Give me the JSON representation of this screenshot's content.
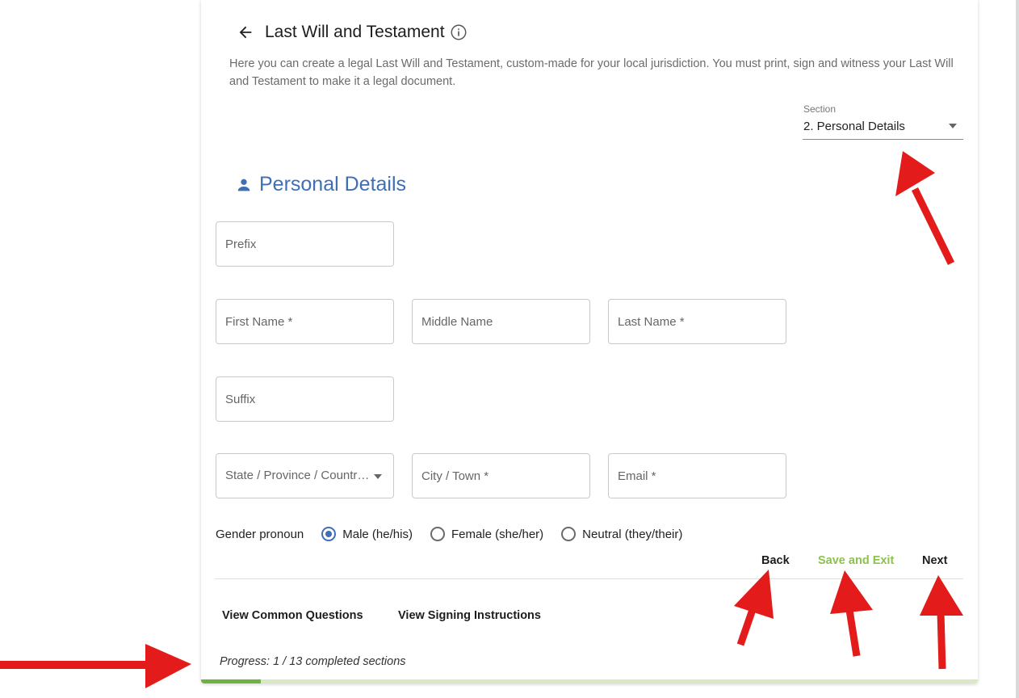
{
  "header": {
    "title": "Last Will and Testament",
    "back_icon": "arrow-left-icon",
    "info_icon": "info-circle-icon"
  },
  "description": "Here you can create a legal Last Will and Testament, custom-made for your local jurisdiction. You must print, sign and witness your Last Will and Testament to make it a legal document.",
  "section_select": {
    "label": "Section",
    "value": "2. Personal Details"
  },
  "personal_details": {
    "heading": "Personal Details",
    "icon": "person-icon"
  },
  "fields": {
    "prefix": {
      "placeholder": "Prefix",
      "value": ""
    },
    "first_name": {
      "placeholder": "First Name *",
      "value": ""
    },
    "middle_name": {
      "placeholder": "Middle Name",
      "value": ""
    },
    "last_name": {
      "placeholder": "Last Name *",
      "value": ""
    },
    "suffix": {
      "placeholder": "Suffix",
      "value": ""
    },
    "state": {
      "placeholder": "State / Province / Country *"
    },
    "city": {
      "placeholder": "City / Town *",
      "value": ""
    },
    "email": {
      "placeholder": "Email *",
      "value": ""
    }
  },
  "gender": {
    "label": "Gender pronoun",
    "options": [
      {
        "label": "Male (he/his)",
        "checked": true
      },
      {
        "label": "Female (she/her)",
        "checked": false
      },
      {
        "label": "Neutral (they/their)",
        "checked": false
      }
    ]
  },
  "nav": {
    "back": "Back",
    "save_exit": "Save and Exit",
    "next": "Next"
  },
  "links": {
    "common_questions": "View Common Questions",
    "signing_instructions": "View Signing Instructions"
  },
  "progress": {
    "text": "Progress: 1 / 13 completed sections",
    "completed": 1,
    "total": 13
  },
  "colors": {
    "accent_blue": "#3f6fb5",
    "save_green": "#8bc34a",
    "progress_green": "#6cb33f",
    "annotation_red": "#e31b1b"
  }
}
